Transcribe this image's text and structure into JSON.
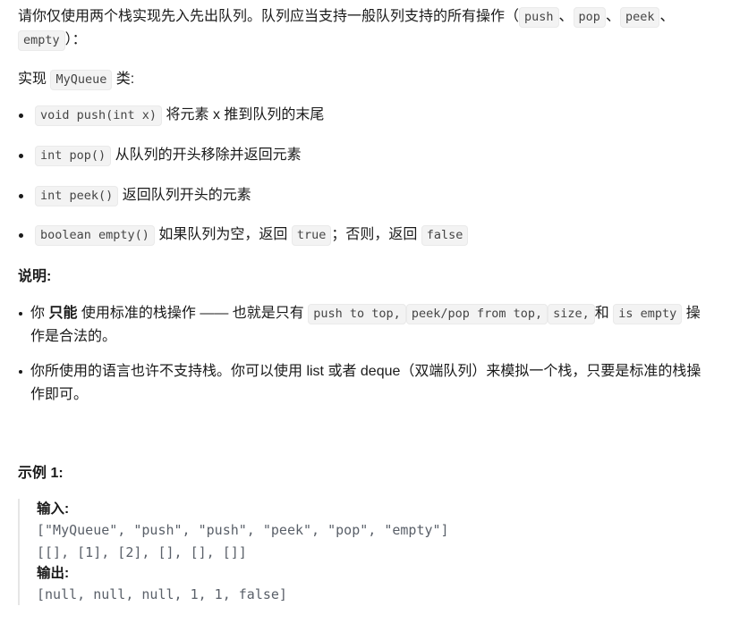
{
  "intro": {
    "seg1": "请你仅使用两个栈实现先入先出队列。队列应当支持一般队列支持的所有操作（",
    "code_push": "push",
    "sep1": "、",
    "code_pop": "pop",
    "sep2": "、",
    "code_peek": "peek",
    "sep3": "、",
    "code_empty": "empty",
    "seg_end": "）："
  },
  "implement_line": {
    "prefix": "实现 ",
    "class_name": "MyQueue",
    "suffix": " 类:"
  },
  "api_methods": [
    {
      "signature": "void push(int x)",
      "description": "将元素 x 推到队列的末尾"
    },
    {
      "signature": "int pop()",
      "description": "从队列的开头移除并返回元素"
    },
    {
      "signature": "int peek()",
      "description": "返回队列开头的元素"
    }
  ],
  "api_empty": {
    "signature": "boolean empty()",
    "text_before": "如果队列为空，返回 ",
    "code_true": "true",
    "text_middle": "；否则，返回 ",
    "code_false": "false"
  },
  "notes_heading": "说明:",
  "note_one": {
    "part1": "你 ",
    "emphasis": "只能",
    "part2": " 使用标准的栈操作 —— 也就是只有 ",
    "code_a": "push to top,",
    "code_b": "peek/pop from top,",
    "code_c": "size,",
    "text_and": "和 ",
    "code_d": "is empty",
    "part3": " 操作是合法的。"
  },
  "note_two": "你所使用的语言也许不支持栈。你可以使用 list 或者 deque（双端队列）来模拟一个栈，只要是标准的栈操作即可。",
  "example": {
    "heading": "示例 1:",
    "input_label": "输入:",
    "input_lines": "[\"MyQueue\", \"push\", \"push\", \"peek\", \"pop\", \"empty\"]\n[[], [1], [2], [], [], []]",
    "output_label": "输出:",
    "output_lines": "[null, null, null, 1, 1, false]"
  },
  "colors": {
    "background": "#ffffff",
    "text": "#1a1a1a",
    "code_text": "#454545",
    "code_background": "#f3f3f3",
    "code_border": "#eaeaea",
    "blockquote_border": "#e6e6e6",
    "block_code_text": "#5a6069"
  }
}
